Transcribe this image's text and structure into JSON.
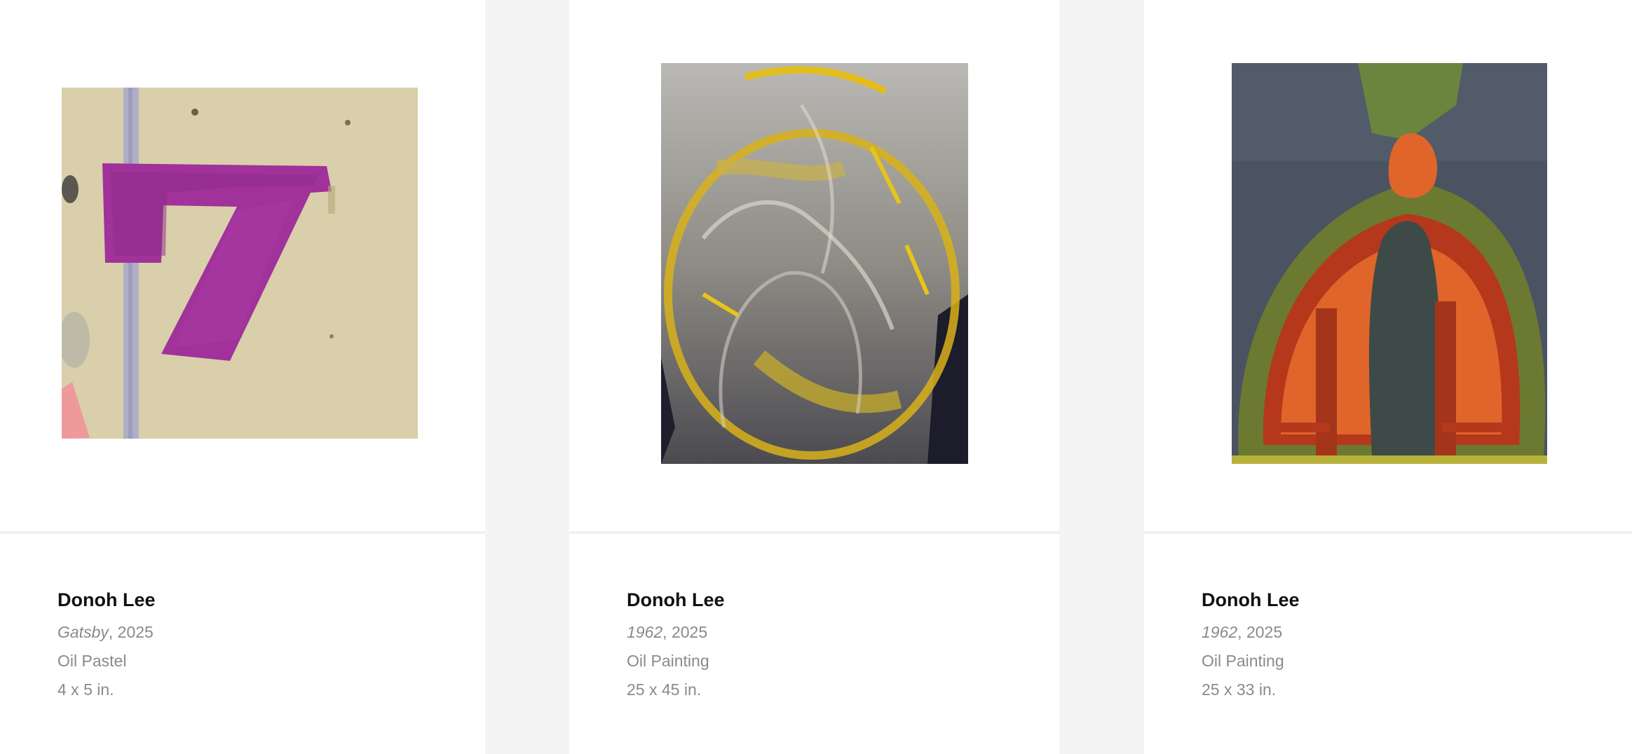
{
  "artworks": [
    {
      "artist": "Donoh Lee",
      "title": "Gatsby",
      "year_suffix": ", 2025",
      "medium": "Oil Pastel",
      "dimensions": "4 x 5 in.",
      "image_subject": "magenta-seven-pastel"
    },
    {
      "artist": "Donoh Lee",
      "title": "1962",
      "year_suffix": ", 2025",
      "medium": "Oil Painting",
      "dimensions": "25 x 45 in.",
      "image_subject": "grey-yellow-abstract"
    },
    {
      "artist": "Donoh Lee",
      "title": "1962",
      "year_suffix": ", 2025",
      "medium": "Oil Painting",
      "dimensions": "25 x 33 in.",
      "image_subject": "orange-arch-figure"
    }
  ],
  "colors": {
    "page_background": "#f4f4f4",
    "card_background": "#ffffff",
    "artist_text": "#111111",
    "meta_text": "#8a8a8a"
  }
}
